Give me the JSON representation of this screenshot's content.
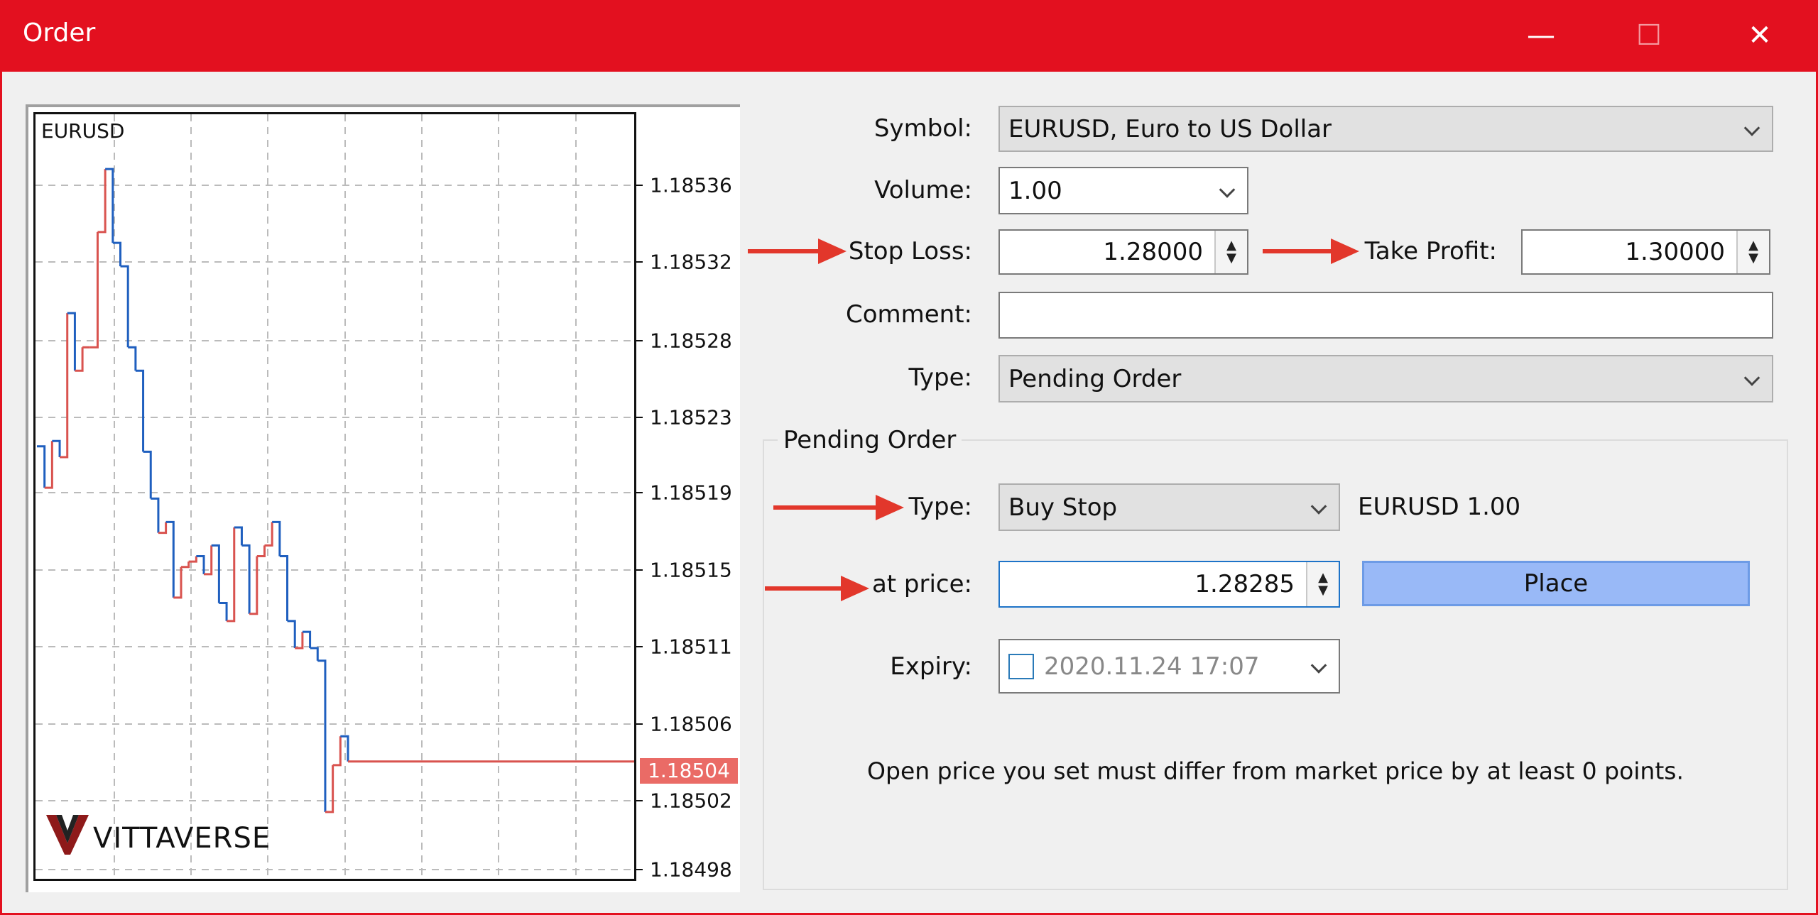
{
  "window": {
    "title": "Order",
    "minimize_icon": "minimize-icon",
    "maximize_icon": "maximize-icon",
    "close_icon": "close-icon",
    "accent": "#e3101f"
  },
  "chart": {
    "symbol": "EURUSD",
    "y_ticks": [
      "1.18536",
      "1.18532",
      "1.18528",
      "1.18523",
      "1.18519",
      "1.18515",
      "1.18511",
      "1.18506",
      "1.18502",
      "1.18498"
    ],
    "current_price": "1.18504",
    "prices": [
      1.185215,
      1.185192,
      1.185218,
      1.185209,
      1.185289,
      1.185257,
      1.18527,
      1.18527,
      1.185334,
      1.185369,
      1.185328,
      1.185315,
      1.18527,
      1.185257,
      1.185212,
      1.185186,
      1.185167,
      1.185173,
      1.185131,
      1.185148,
      1.185151,
      1.185154,
      1.185144,
      1.18516,
      1.185128,
      1.185118,
      1.18517,
      1.18516,
      1.185122,
      1.185154,
      1.18516,
      1.185173,
      1.185154,
      1.185118,
      1.185103,
      1.185112,
      1.185103,
      1.185096,
      1.185012,
      1.185038,
      1.185054,
      1.18504
    ],
    "up_color": "#d9534f",
    "down_color": "#1f5fbf",
    "watermark": "VITTAVERSE"
  },
  "form": {
    "symbol_label": "Symbol:",
    "symbol_value": "EURUSD, Euro to US Dollar",
    "volume_label": "Volume:",
    "volume_value": "1.00",
    "stop_loss_label": "Stop Loss:",
    "stop_loss_value": "1.28000",
    "take_profit_label": "Take Profit:",
    "take_profit_value": "1.30000",
    "comment_label": "Comment:",
    "comment_value": "",
    "type_label": "Type:",
    "type_value": "Pending Order"
  },
  "pending": {
    "legend": "Pending Order",
    "type_label": "Type:",
    "type_value": "Buy Stop",
    "summary": "EURUSD 1.00",
    "price_label": "at price:",
    "price_value": "1.28285",
    "place_label": "Place",
    "expiry_label": "Expiry:",
    "expiry_value": "2020.11.24 17:07",
    "expiry_checked": false,
    "note": "Open price you set must differ from market price by at least 0 points."
  },
  "annotation_color": "#e2372b"
}
